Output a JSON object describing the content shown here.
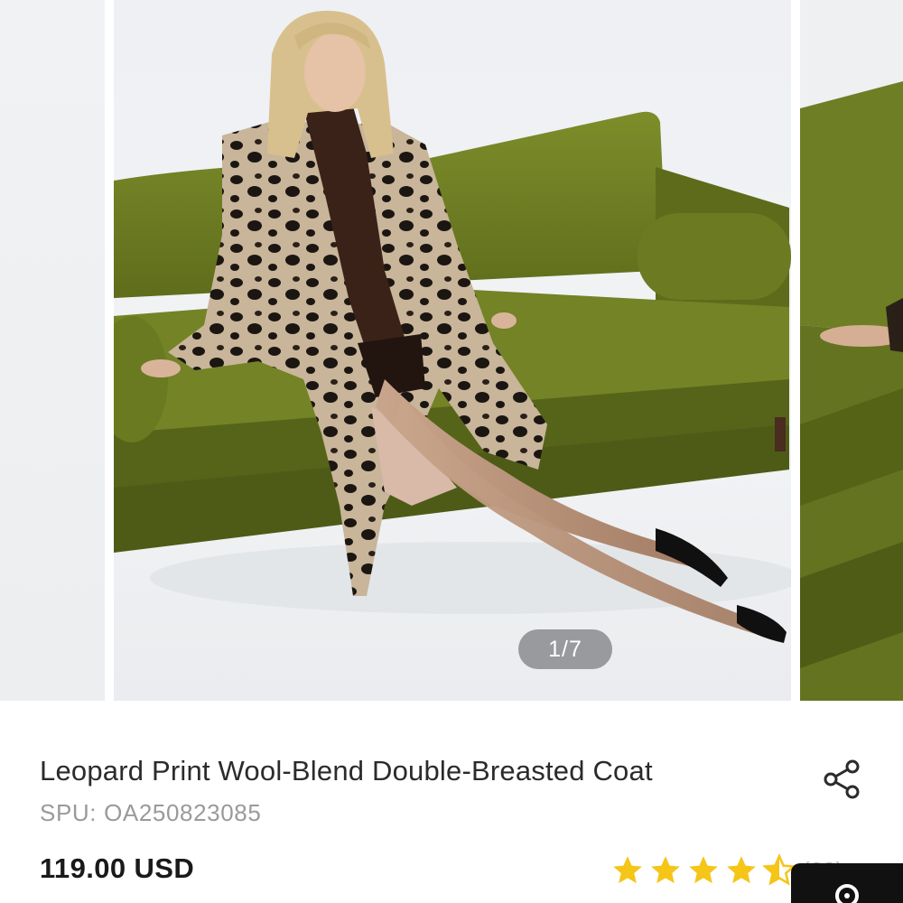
{
  "gallery": {
    "current_index": "1/7",
    "slide_alt": "Leopard print coat product photo"
  },
  "product": {
    "title": "Leopard Print Wool-Blend Double-Breasted Coat",
    "spu_label": "SPU:",
    "spu_value": "OA250823085",
    "price": "119.00 USD",
    "rating": 4.5,
    "review_count": "(69) >"
  },
  "icons": {
    "share": "share-icon",
    "star": "star-icon",
    "chat": "chat-icon"
  },
  "colors": {
    "star": "#f5c518",
    "sofa": "#6f7f22",
    "pager_bg": "#7a7c7f",
    "title": "#2b2b2b",
    "muted": "#9a9a9a",
    "fab": "#111111"
  }
}
